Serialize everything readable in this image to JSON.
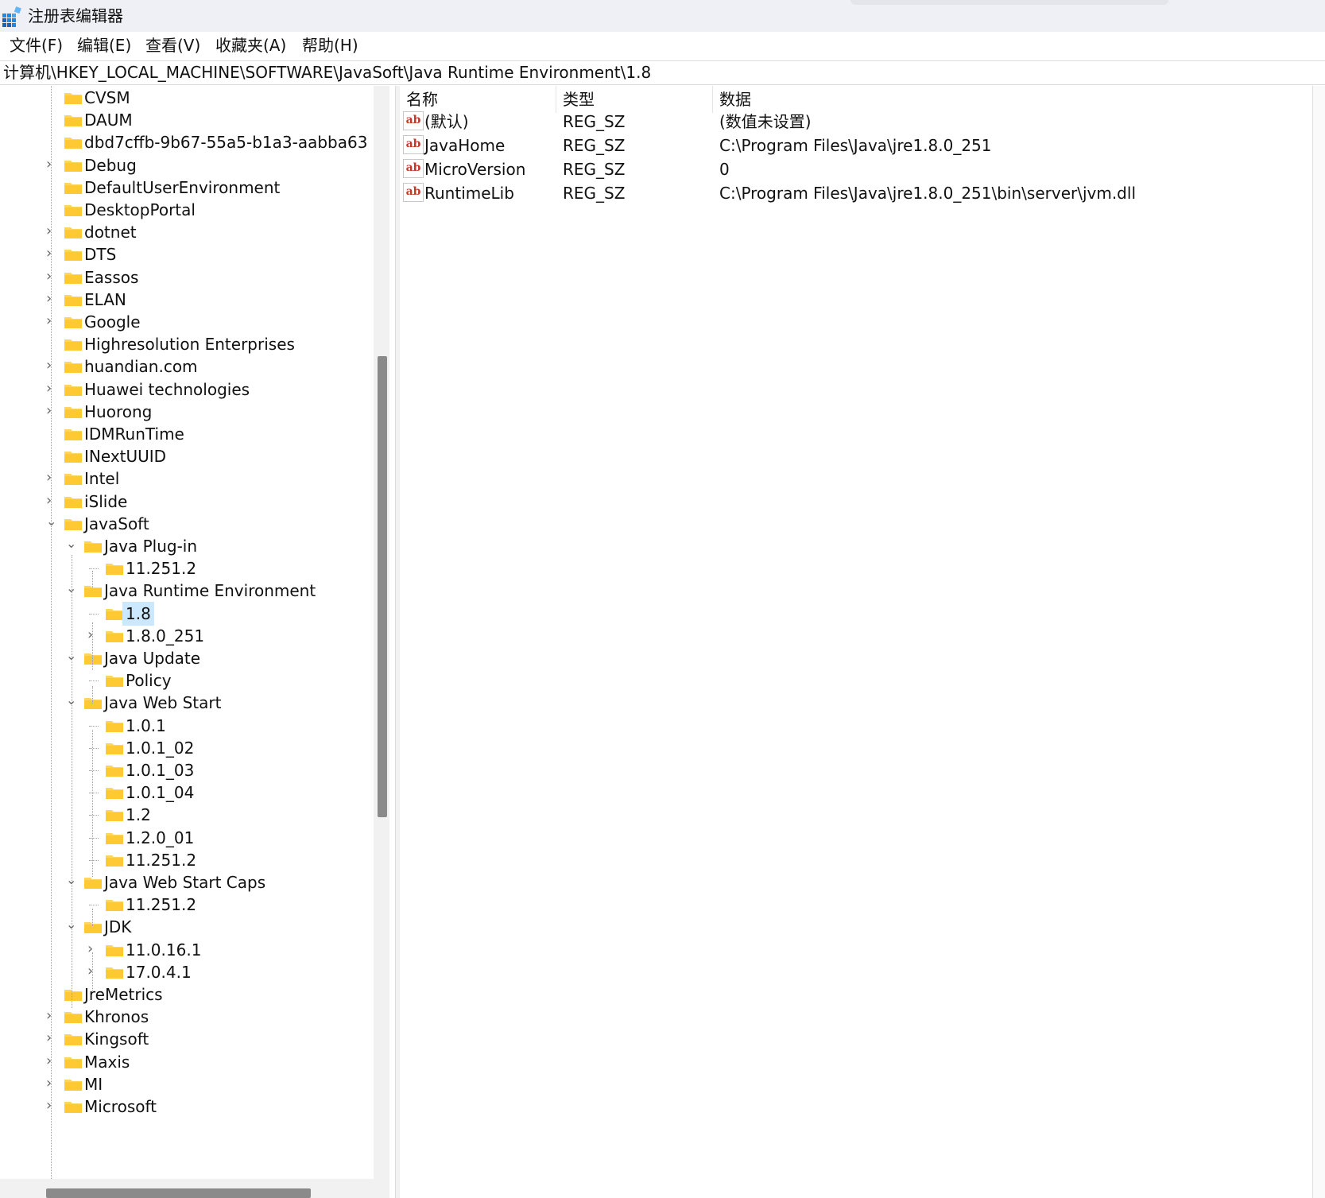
{
  "window": {
    "title": "注册表编辑器",
    "accent": "#0078d4"
  },
  "menu": [
    "文件(F)",
    "编辑(E)",
    "查看(V)",
    "收藏夹(A)",
    "帮助(H)"
  ],
  "address": "计算机\\HKEY_LOCAL_MACHINE\\SOFTWARE\\JavaSoft\\Java Runtime Environment\\1.8",
  "tree": [
    {
      "label": "CVSM",
      "level": 0,
      "expander": "none"
    },
    {
      "label": "DAUM",
      "level": 0,
      "expander": "none"
    },
    {
      "label": "dbd7cffb-9b67-55a5-b1a3-aabba63",
      "level": 0,
      "expander": "none"
    },
    {
      "label": "Debug",
      "level": 0,
      "expander": "collapsed"
    },
    {
      "label": "DefaultUserEnvironment",
      "level": 0,
      "expander": "none"
    },
    {
      "label": "DesktopPortal",
      "level": 0,
      "expander": "none"
    },
    {
      "label": "dotnet",
      "level": 0,
      "expander": "collapsed"
    },
    {
      "label": "DTS",
      "level": 0,
      "expander": "collapsed"
    },
    {
      "label": "Eassos",
      "level": 0,
      "expander": "collapsed"
    },
    {
      "label": "ELAN",
      "level": 0,
      "expander": "collapsed"
    },
    {
      "label": "Google",
      "level": 0,
      "expander": "collapsed"
    },
    {
      "label": "Highresolution Enterprises",
      "level": 0,
      "expander": "none"
    },
    {
      "label": "huandian.com",
      "level": 0,
      "expander": "collapsed"
    },
    {
      "label": "Huawei technologies",
      "level": 0,
      "expander": "collapsed"
    },
    {
      "label": "Huorong",
      "level": 0,
      "expander": "collapsed"
    },
    {
      "label": "IDMRunTime",
      "level": 0,
      "expander": "none"
    },
    {
      "label": "INextUUID",
      "level": 0,
      "expander": "none"
    },
    {
      "label": "Intel",
      "level": 0,
      "expander": "collapsed"
    },
    {
      "label": "iSlide",
      "level": 0,
      "expander": "collapsed"
    },
    {
      "label": "JavaSoft",
      "level": 0,
      "expander": "expanded"
    },
    {
      "label": "Java Plug-in",
      "level": 1,
      "expander": "expanded"
    },
    {
      "label": "11.251.2",
      "level": 2,
      "expander": "none"
    },
    {
      "label": "Java Runtime Environment",
      "level": 1,
      "expander": "expanded"
    },
    {
      "label": "1.8",
      "level": 2,
      "expander": "none",
      "selected": true
    },
    {
      "label": "1.8.0_251",
      "level": 2,
      "expander": "collapsed"
    },
    {
      "label": "Java Update",
      "level": 1,
      "expander": "expanded"
    },
    {
      "label": "Policy",
      "level": 2,
      "expander": "none"
    },
    {
      "label": "Java Web Start",
      "level": 1,
      "expander": "expanded"
    },
    {
      "label": "1.0.1",
      "level": 2,
      "expander": "none"
    },
    {
      "label": "1.0.1_02",
      "level": 2,
      "expander": "none"
    },
    {
      "label": "1.0.1_03",
      "level": 2,
      "expander": "none"
    },
    {
      "label": "1.0.1_04",
      "level": 2,
      "expander": "none"
    },
    {
      "label": "1.2",
      "level": 2,
      "expander": "none"
    },
    {
      "label": "1.2.0_01",
      "level": 2,
      "expander": "none"
    },
    {
      "label": "11.251.2",
      "level": 2,
      "expander": "none"
    },
    {
      "label": "Java Web Start Caps",
      "level": 1,
      "expander": "expanded"
    },
    {
      "label": "11.251.2",
      "level": 2,
      "expander": "none"
    },
    {
      "label": "JDK",
      "level": 1,
      "expander": "expanded"
    },
    {
      "label": "11.0.16.1",
      "level": 2,
      "expander": "collapsed"
    },
    {
      "label": "17.0.4.1",
      "level": 2,
      "expander": "collapsed"
    },
    {
      "label": "JreMetrics",
      "level": 0,
      "expander": "none"
    },
    {
      "label": "Khronos",
      "level": 0,
      "expander": "collapsed"
    },
    {
      "label": "Kingsoft",
      "level": 0,
      "expander": "collapsed"
    },
    {
      "label": "Maxis",
      "level": 0,
      "expander": "collapsed"
    },
    {
      "label": "MI",
      "level": 0,
      "expander": "collapsed"
    },
    {
      "label": "Microsoft",
      "level": 0,
      "expander": "collapsed"
    }
  ],
  "values": {
    "columns": {
      "name": "名称",
      "type": "类型",
      "data": "数据"
    },
    "rows": [
      {
        "icon": "ab",
        "name": "(默认)",
        "type": "REG_SZ",
        "data": "(数值未设置)"
      },
      {
        "icon": "ab",
        "name": "JavaHome",
        "type": "REG_SZ",
        "data": "C:\\Program Files\\Java\\jre1.8.0_251"
      },
      {
        "icon": "ab",
        "name": "MicroVersion",
        "type": "REG_SZ",
        "data": "0"
      },
      {
        "icon": "ab",
        "name": "RuntimeLib",
        "type": "REG_SZ",
        "data": "C:\\Program Files\\Java\\jre1.8.0_251\\bin\\server\\jvm.dll"
      }
    ]
  },
  "colors": {
    "folder": "#ffd65c",
    "selection": "#cce8ff",
    "scroll_thumb": "#8a8a8a"
  }
}
